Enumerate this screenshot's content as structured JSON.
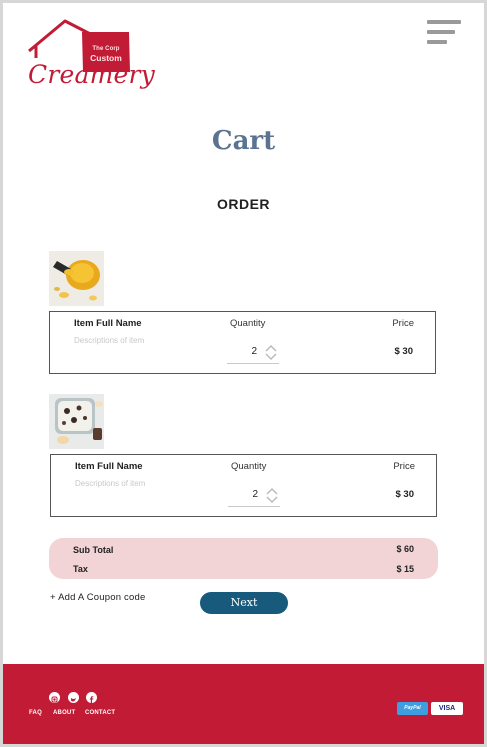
{
  "brand": {
    "corp": "The Corp",
    "custom": "Custom",
    "name": "Creamery",
    "color": "#c21b35"
  },
  "menu_icon": "hamburger-menu-icon",
  "page": {
    "title": "Cart",
    "order_heading": "ORDER"
  },
  "items": [
    {
      "name": "Item Full Name",
      "description": "Descriptions of item",
      "quantity_label": "Quantity",
      "quantity": "2",
      "price_label": "Price",
      "price": "$ 30"
    },
    {
      "name": "Item Full Name",
      "description": "Descriptions of item",
      "quantity_label": "Quantity",
      "quantity": "2",
      "price_label": "Price",
      "price": "$ 30"
    }
  ],
  "summary": {
    "subtotal_label": "Sub Total",
    "subtotal": "$ 60",
    "tax_label": "Tax",
    "tax": "$ 15"
  },
  "coupon_link": "+ Add A Coupon code",
  "next_button": "Next",
  "footer": {
    "social_icons": [
      "instagram-icon",
      "twitter-icon",
      "facebook-icon"
    ],
    "links": [
      "FAQ",
      "ABOUT",
      "CONTACT"
    ],
    "payments": [
      "PayPal",
      "VISA"
    ]
  },
  "colors": {
    "accent": "#c21b35",
    "title": "#5b7390",
    "button": "#175a7c",
    "summary_bg": "#f2d3d6"
  }
}
